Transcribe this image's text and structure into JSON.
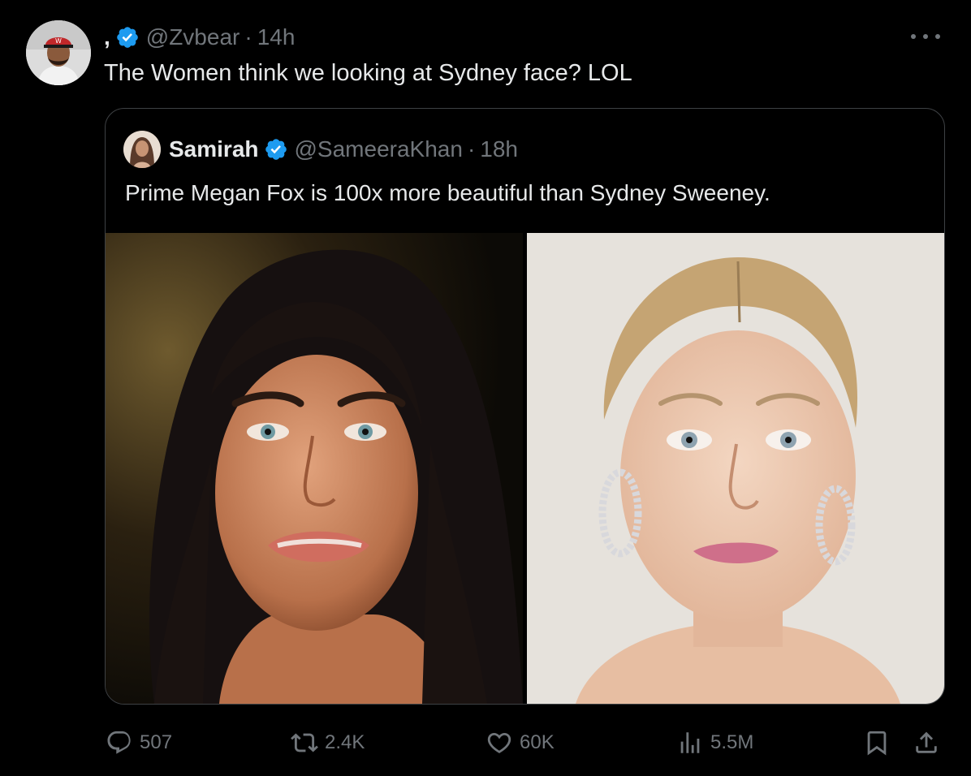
{
  "post": {
    "display_name": ",",
    "handle": "@Zvbear",
    "separator": "·",
    "time": "14h",
    "text": "The Women think we looking at Sydney face? LOL"
  },
  "quoted_post": {
    "display_name": "Samirah",
    "handle": "@SameeraKhan",
    "separator": "·",
    "time": "18h",
    "text": "Prime Megan Fox is 100x more beautiful than Sydney Sweeney."
  },
  "actions": {
    "replies": "507",
    "reposts": "2.4K",
    "likes": "60K",
    "views": "5.5M"
  },
  "icons": {
    "verified": "verified-badge-icon",
    "more": "more-options-icon",
    "reply": "reply-icon",
    "repost": "repost-icon",
    "like": "heart-icon",
    "views": "views-icon",
    "bookmark": "bookmark-icon",
    "share": "share-icon"
  },
  "colors": {
    "background": "#000000",
    "text_primary": "#e7e9ea",
    "text_secondary": "#71767b",
    "verified_blue": "#1d9bf0",
    "border": "#3e4144"
  }
}
